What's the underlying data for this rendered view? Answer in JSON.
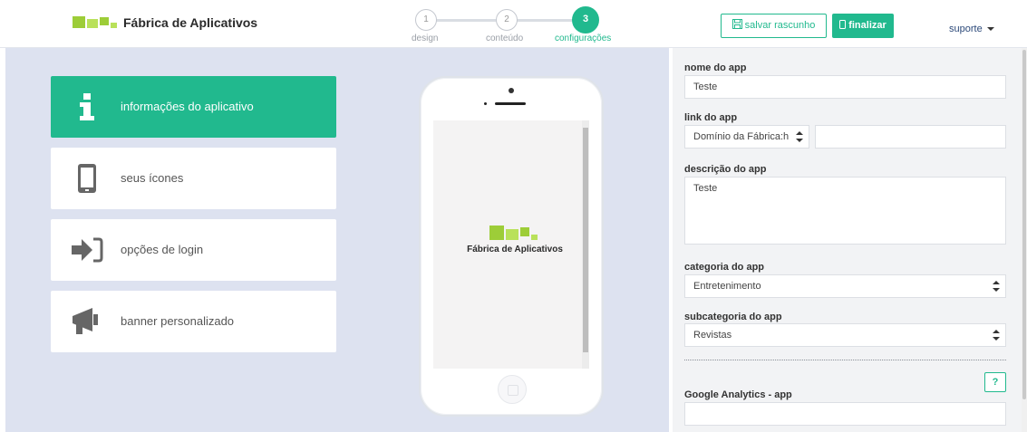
{
  "header": {
    "logo_text": "Fábrica de Aplicativos",
    "steps": [
      {
        "number": "1",
        "label": "design"
      },
      {
        "number": "2",
        "label": "conteúdo"
      },
      {
        "number": "3",
        "label": "configurações"
      }
    ],
    "save_draft_label": "salvar rascunho",
    "finish_label": "finalizar",
    "user_label": "suporte"
  },
  "menu": {
    "items": [
      {
        "label": "informações do aplicativo",
        "icon": "info-icon",
        "active": true
      },
      {
        "label": "seus ícones",
        "icon": "phone-icon",
        "active": false
      },
      {
        "label": "opções de login",
        "icon": "sign-in-icon",
        "active": false
      },
      {
        "label": "banner personalizado",
        "icon": "megaphone-icon",
        "active": false
      }
    ]
  },
  "preview": {
    "logo_text": "Fábrica de Aplicativos"
  },
  "form": {
    "app_name": {
      "label": "nome do app",
      "value": "Teste"
    },
    "app_link": {
      "label": "link do app",
      "domain_value": "Domínio da Fábrica:h",
      "path_value": ""
    },
    "app_description": {
      "label": "descrição do app",
      "value": "Teste"
    },
    "app_category": {
      "label": "categoria do app",
      "value": "Entretenimento"
    },
    "app_subcategory": {
      "label": "subcategoria do app",
      "value": "Revistas"
    },
    "google_analytics": {
      "label": "Google Analytics - app",
      "value": "",
      "help": "?"
    }
  },
  "colors": {
    "accent": "#21b98e",
    "left_background": "#dde2f0",
    "right_background": "#f2f3f5"
  }
}
